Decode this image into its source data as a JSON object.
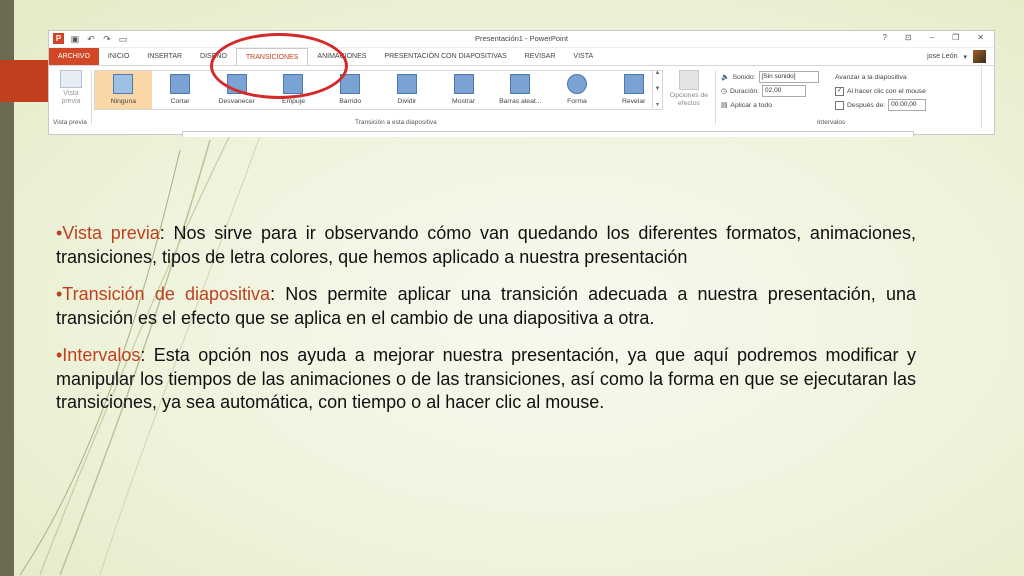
{
  "window": {
    "title": "Presentación1 - PowerPoint",
    "controls": [
      "?",
      "⊡",
      "–",
      "❐",
      "✕"
    ],
    "qat_icons": [
      "powerpoint-logo",
      "save-icon",
      "undo-icon",
      "redo-icon",
      "slideshow-icon"
    ]
  },
  "tabs": [
    {
      "label": "ARCHIVO",
      "type": "file"
    },
    {
      "label": "INICIO"
    },
    {
      "label": "INSERTAR"
    },
    {
      "label": "DISEÑO"
    },
    {
      "label": "TRANSICIONES",
      "active": true
    },
    {
      "label": "ANIMACIONES"
    },
    {
      "label": "PRESENTACIÓN CON DIAPOSITIVAS"
    },
    {
      "label": "REVISAR"
    },
    {
      "label": "VISTA"
    }
  ],
  "user": {
    "name": "jose León",
    "caret": "▾"
  },
  "ribbon": {
    "preview_group": {
      "button_label": "Vista previa",
      "group_label": "Vista previa"
    },
    "transitions": {
      "items": [
        {
          "label": "Ninguna",
          "selected": true
        },
        {
          "label": "Cortar"
        },
        {
          "label": "Desvanecer"
        },
        {
          "label": "Empuje"
        },
        {
          "label": "Barrido"
        },
        {
          "label": "Dividir"
        },
        {
          "label": "Mostrar"
        },
        {
          "label": "Barras aleat..."
        },
        {
          "label": "Forma"
        },
        {
          "label": "Revelar"
        }
      ],
      "options_label": "Opciones de efectos",
      "group_label": "Transición a esta diapositiva"
    },
    "timing": {
      "sound_label": "Sonido:",
      "sound_value": "[Sin sonido]",
      "duration_label": "Duración:",
      "duration_value": "02,00",
      "apply_all_label": "Aplicar a todo",
      "advance_label": "Avanzar a la diapositiva",
      "on_click_label": "Al hacer clic con el mouse",
      "on_click_checked": true,
      "after_label": "Después de:",
      "after_checked": false,
      "after_value": "00:00,00",
      "group_label": "Intervalos"
    }
  },
  "content": {
    "paragraphs": [
      {
        "term": "•Vista previa",
        "text": ": Nos sirve para ir observando cómo van quedando los diferentes formatos, animaciones, transiciones, tipos de letra colores,  que hemos aplicado a nuestra presentación"
      },
      {
        "term": "•Transición de diapositiva",
        "text": ": Nos permite aplicar una transición adecuada a nuestra presentación, una transición es el efecto que se aplica en el cambio de una diapositiva a otra."
      },
      {
        "term": "•Intervalos",
        "text": ": Esta opción nos ayuda a mejorar nuestra presentación, ya que aquí podremos modificar y manipular los tiempos de las animaciones o de las transiciones, así como la forma en que se ejecutaran las transiciones, ya sea automática, con tiempo o al hacer clic al mouse."
      }
    ]
  },
  "colors": {
    "accent": "#c0401e",
    "highlight_ellipse": "#d42a2a",
    "sidebar": "#6b6a52"
  }
}
